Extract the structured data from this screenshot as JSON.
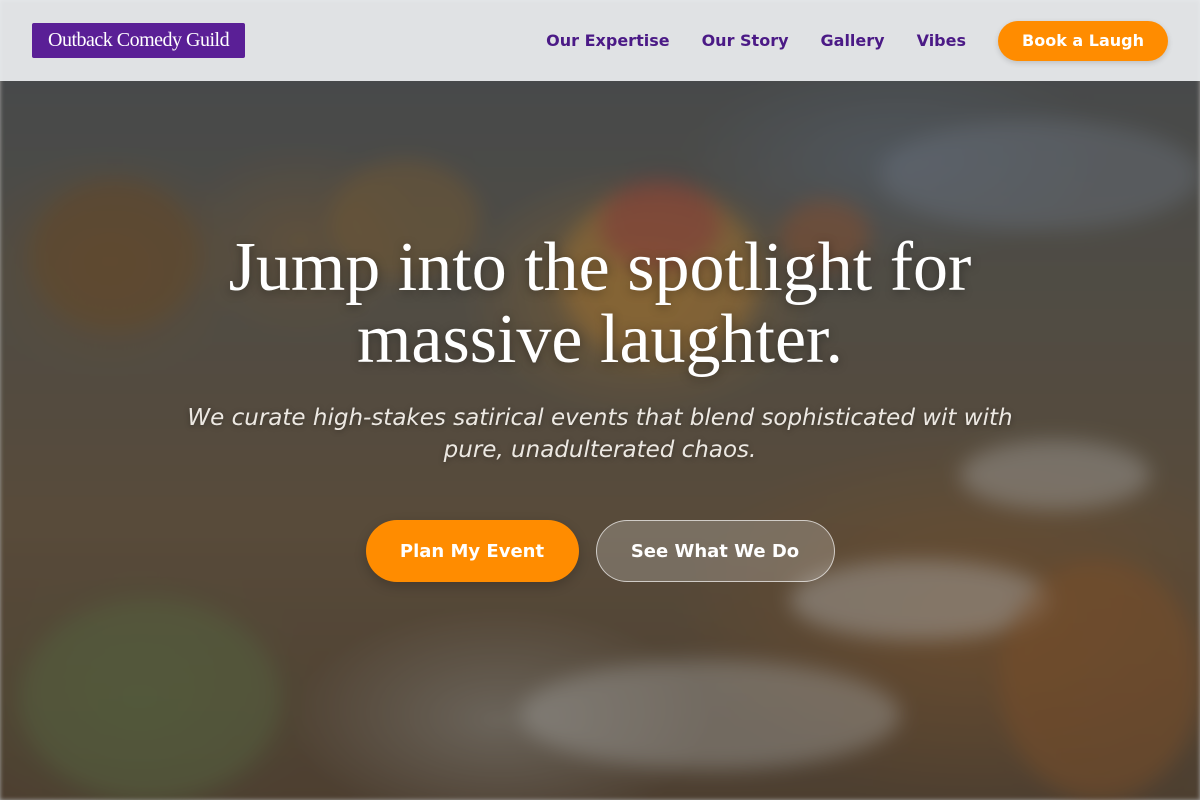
{
  "brand": {
    "name": "Outback Comedy Guild",
    "color": "#5a1f96"
  },
  "nav": {
    "links": [
      {
        "label": "Our Expertise"
      },
      {
        "label": "Our Story"
      },
      {
        "label": "Gallery"
      },
      {
        "label": "Vibes"
      }
    ],
    "cta_label": "Book a Laugh",
    "link_color": "#4b1a86"
  },
  "hero": {
    "title": "Jump into the spotlight for massive laughter.",
    "subtitle": "We curate high-stakes satirical events that blend sophisticated wit with pure, unadulterated chaos.",
    "primary_cta": "Plan My Event",
    "secondary_cta": "See What We Do",
    "background_image": "blurred banquet table with glasses, plates and floral centerpiece"
  },
  "colors": {
    "accent": "#ff8c00",
    "navbar_bg": "#eceef0"
  }
}
